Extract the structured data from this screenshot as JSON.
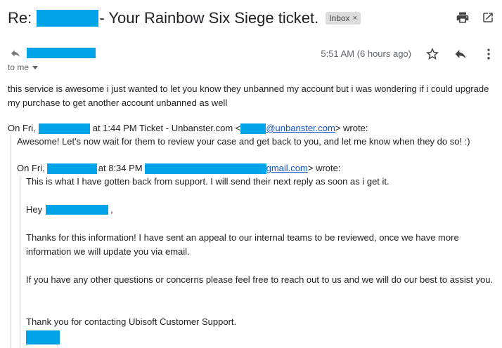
{
  "subject": {
    "prefix": "Re: ",
    "suffix": "- Your Rainbow Six Siege ticket.",
    "label": "Inbox",
    "label_close": "×"
  },
  "message": {
    "time": "5:51 AM (6 hours ago)",
    "to": "to me",
    "body": "this service is awesome i just wanted to let you know they unbanned my account but i was wondering if i could upgrade my purchase to get another account unbanned as well"
  },
  "quote1": {
    "on": "On Fri,",
    "header_mid": "at 1:44 PM Ticket - Unbanster.com <",
    "email_domain": "@unbanster.com",
    "wrote": "> wrote:",
    "text": "Awesome! Let's now wait for them to review your case and get back to you, and let me know when they do so! :)"
  },
  "quote2": {
    "on": "On Fri,",
    "header_mid": "at 8:34 PM",
    "email_domain": "gmail.com",
    "wrote": "> wrote:",
    "p1": "This is what I have gotten back from support. I will send their next reply as soon as i get it.",
    "hey": "Hey",
    "comma": ",",
    "p2": "Thanks for this information! I have sent an appeal to our internal teams to be reviewed, once we have more information we will update you via email.",
    "p3": "If you have any other questions or concerns please feel free to reach out to us and we will do our best to assist you.",
    "p4": "Thank you for contacting Ubisoft Customer Support."
  },
  "icons": {
    "print": "print-icon",
    "popout": "open-in-new-window-icon",
    "sender_reply": "reply-arrow-icon",
    "star": "star-icon",
    "reply": "reply-icon",
    "more": "more-vert-icon"
  },
  "colors": {
    "redaction": "#00a2e8",
    "link": "#1155cc",
    "quote_bar": "#cccccc",
    "secondary_text": "#5f6368"
  }
}
